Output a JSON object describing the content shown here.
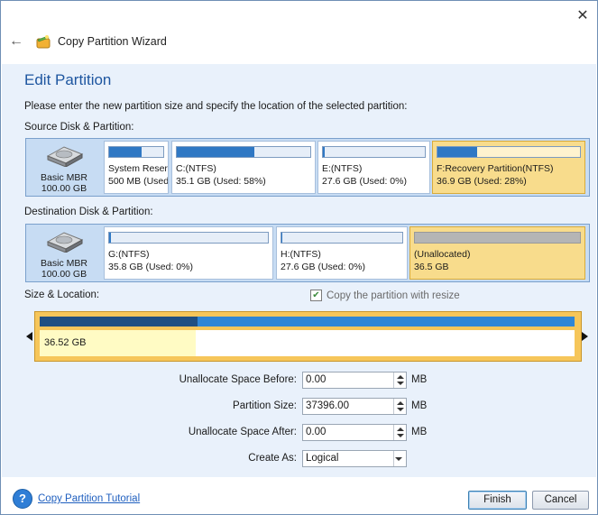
{
  "window": {
    "title": "Copy Partition Wizard"
  },
  "page": {
    "heading": "Edit Partition",
    "description": "Please enter the new partition size and specify the location of the selected partition:"
  },
  "source": {
    "label": "Source Disk & Partition:",
    "disk_type": "Basic MBR",
    "disk_size": "100.00 GB",
    "partitions": [
      {
        "name": "System Reserv",
        "size": "500 MB (Used:",
        "used_fraction": 0.6,
        "selected": false
      },
      {
        "name": "C:(NTFS)",
        "size": "35.1 GB (Used: 58%)",
        "used_fraction": 0.58,
        "selected": false
      },
      {
        "name": "E:(NTFS)",
        "size": "27.6 GB (Used: 0%)",
        "used_fraction": 0.02,
        "selected": false
      },
      {
        "name": "F:Recovery Partition(NTFS)",
        "size": "36.9 GB (Used: 28%)",
        "used_fraction": 0.28,
        "selected": true
      }
    ]
  },
  "destination": {
    "label": "Destination Disk & Partition:",
    "disk_type": "Basic MBR",
    "disk_size": "100.00 GB",
    "partitions": [
      {
        "name": "G:(NTFS)",
        "size": "35.8 GB (Used: 0%)",
        "used_fraction": 0.01,
        "selected": false
      },
      {
        "name": "H:(NTFS)",
        "size": "27.6 GB (Used: 0%)",
        "used_fraction": 0.01,
        "selected": false
      },
      {
        "name": "(Unallocated)",
        "size": "36.5 GB",
        "used_fraction": 0,
        "selected": true
      }
    ]
  },
  "size_location": {
    "label": "Size & Location:",
    "resize_checkbox_label": "Copy the partition with resize",
    "resize_checked": true,
    "size_text": "36.52 GB"
  },
  "form": {
    "before_label": "Unallocate Space Before:",
    "before_value": "0.00",
    "size_label": "Partition Size:",
    "size_value": "37396.00",
    "after_label": "Unallocate Space After:",
    "after_value": "0.00",
    "unit": "MB",
    "create_as_label": "Create As:",
    "create_as_value": "Logical"
  },
  "footer": {
    "tutorial_link": "Copy Partition Tutorial",
    "finish": "Finish",
    "cancel": "Cancel"
  },
  "colors": {
    "accent": "#1e56a0",
    "selected": "#f8dc8c",
    "bar_fill": "#2f78c4",
    "band": "#e9f1fb"
  }
}
